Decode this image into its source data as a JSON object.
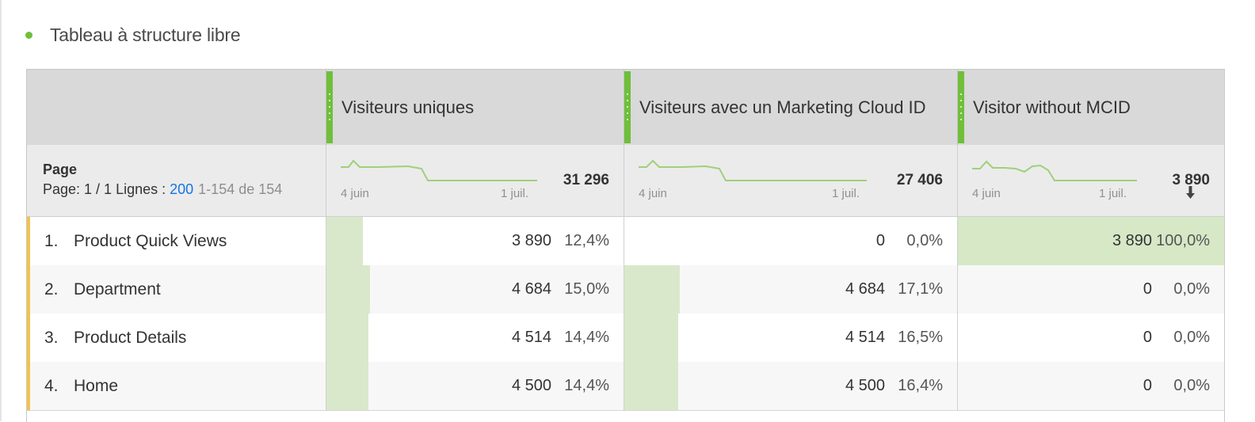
{
  "panel": {
    "title": "Tableau à structure libre"
  },
  "columns": [
    {
      "label": "Visiteurs uniques"
    },
    {
      "label": "Visiteurs avec un Marketing Cloud ID"
    },
    {
      "label": "Visitor without MCID"
    }
  ],
  "dimension": {
    "title": "Page",
    "page_prefix": "Page: 1 / 1 Lignes : ",
    "rows_link": "200",
    "range": "1-154 de 154"
  },
  "summary": [
    {
      "total": "31 296",
      "date_start": "4 juin",
      "date_end": "1 juil.",
      "arrow": false
    },
    {
      "total": "27 406",
      "date_start": "4 juin",
      "date_end": "1 juil.",
      "arrow": false
    },
    {
      "total": "3 890",
      "date_start": "4 juin",
      "date_end": "1 juil.",
      "arrow": true
    }
  ],
  "rows": [
    {
      "num": "1.",
      "label": "Product Quick Views",
      "cells": [
        {
          "value": "3 890",
          "pct": "12,4%",
          "fraction": 0.124
        },
        {
          "value": "0",
          "pct": "0,0%",
          "fraction": 0.0
        },
        {
          "value": "3 890",
          "pct": "100,0%",
          "fraction": 1.0
        }
      ]
    },
    {
      "num": "2.",
      "label": "Department",
      "cells": [
        {
          "value": "4 684",
          "pct": "15,0%",
          "fraction": 0.15
        },
        {
          "value": "4 684",
          "pct": "17,1%",
          "fraction": 0.171
        },
        {
          "value": "0",
          "pct": "0,0%",
          "fraction": 0.0
        }
      ]
    },
    {
      "num": "3.",
      "label": "Product Details",
      "cells": [
        {
          "value": "4 514",
          "pct": "14,4%",
          "fraction": 0.144
        },
        {
          "value": "4 514",
          "pct": "16,5%",
          "fraction": 0.165
        },
        {
          "value": "0",
          "pct": "0,0%",
          "fraction": 0.0
        }
      ]
    },
    {
      "num": "4.",
      "label": "Home",
      "cells": [
        {
          "value": "4 500",
          "pct": "14,4%",
          "fraction": 0.144
        },
        {
          "value": "4 500",
          "pct": "16,4%",
          "fraction": 0.164
        },
        {
          "value": "0",
          "pct": "0,0%",
          "fraction": 0.0
        }
      ]
    }
  ],
  "colors": {
    "accent_green": "#6fbf3a",
    "bar_fill": "#d9e8cb",
    "row_accent": "#f2c34b",
    "link_blue": "#1473e6"
  }
}
